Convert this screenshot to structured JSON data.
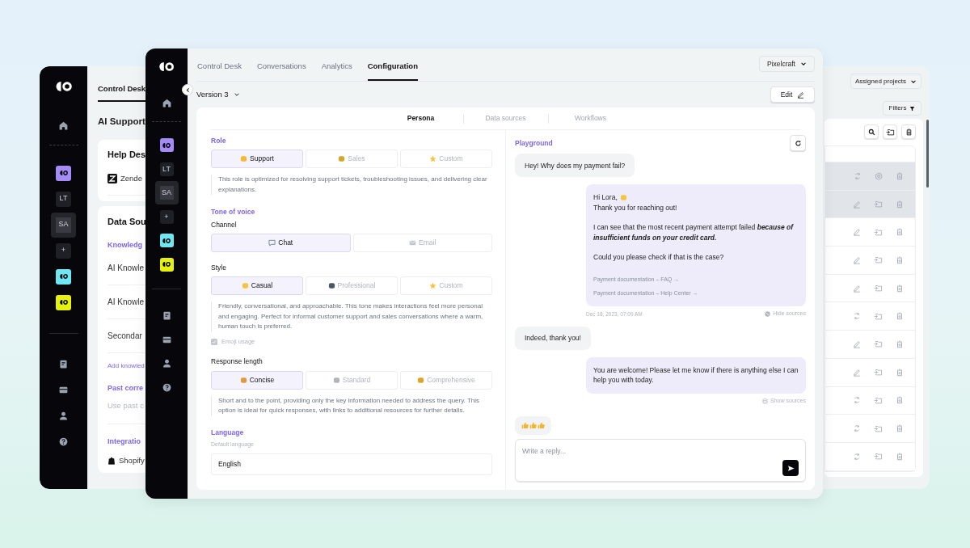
{
  "left_window": {
    "sidebar": {
      "workspaces": [
        {
          "kind": "logo",
          "color": "#a48bf5",
          "selected": false
        },
        {
          "kind": "initials",
          "label": "LT",
          "selected": false
        },
        {
          "kind": "initials",
          "label": "SA",
          "selected": true
        },
        {
          "kind": "add",
          "label": "+",
          "selected": false
        },
        {
          "kind": "logo",
          "color": "#6ee7f2",
          "selected": false
        },
        {
          "kind": "logo",
          "color": "#e6f20c",
          "selected": false
        }
      ]
    },
    "tab": "Control Desk",
    "heading": "AI Support",
    "cards": [
      {
        "title": "Help Des",
        "lines": [
          {
            "kind": "integration",
            "text": "Zende"
          }
        ]
      },
      {
        "title": "Data Sou",
        "lines": [
          {
            "kind": "section",
            "text": "Knowledg"
          },
          {
            "kind": "item",
            "text": "AI Knowle"
          },
          {
            "kind": "item",
            "text": "AI Knowle"
          },
          {
            "kind": "item",
            "text": "Secondar"
          },
          {
            "kind": "link",
            "text": "Add knowled"
          },
          {
            "kind": "section",
            "text": "Past corre"
          },
          {
            "kind": "hint",
            "text": "Use past c"
          },
          {
            "kind": "section",
            "text": "Integratio"
          },
          {
            "kind": "integration",
            "text": "Shopify"
          }
        ]
      }
    ]
  },
  "right_window": {
    "project_select": "Assigned projects",
    "filters": "Filters",
    "rows": [
      {
        "kind": "sync-settings",
        "highlighted": true
      },
      {
        "kind": "edit-move",
        "highlighted": true
      },
      {
        "kind": "edit-move",
        "highlighted": false
      },
      {
        "kind": "edit-move",
        "highlighted": false
      },
      {
        "kind": "edit-move",
        "highlighted": false
      },
      {
        "kind": "sync-move",
        "highlighted": false
      },
      {
        "kind": "edit-move",
        "highlighted": false
      },
      {
        "kind": "edit-move",
        "highlighted": false
      },
      {
        "kind": "sync-move",
        "highlighted": false
      },
      {
        "kind": "sync-move",
        "highlighted": false
      },
      {
        "kind": "sync-move",
        "highlighted": false
      }
    ]
  },
  "main_window": {
    "sidebar": {
      "workspaces": [
        {
          "kind": "logo",
          "color": "#a48bf5",
          "selected": false
        },
        {
          "kind": "initials",
          "label": "LT",
          "selected": false
        },
        {
          "kind": "initials",
          "label": "SA",
          "selected": true
        },
        {
          "kind": "add",
          "label": "+",
          "selected": false
        },
        {
          "kind": "logo",
          "color": "#6ee7f2",
          "selected": false
        },
        {
          "kind": "logo",
          "color": "#e6f20c",
          "selected": false
        }
      ]
    },
    "tabs": [
      {
        "label": "Control Desk",
        "selected": false
      },
      {
        "label": "Conversations",
        "selected": false
      },
      {
        "label": "Analytics",
        "selected": false
      },
      {
        "label": "Configuration",
        "selected": true
      }
    ],
    "workspace_select": "Pixelcraft",
    "version_select": "Version 3",
    "edit_button": "Edit",
    "subtabs": [
      {
        "label": "Persona",
        "selected": true
      },
      {
        "label": "Data sources",
        "selected": false
      },
      {
        "label": "Workflows",
        "selected": false
      }
    ],
    "persona": [
      {
        "kind": "heading",
        "text": "Role"
      },
      {
        "kind": "options",
        "options": [
          {
            "label": "Support",
            "kind": "handshake",
            "selected": true
          },
          {
            "label": "Sales",
            "kind": "moneybag",
            "selected": false
          },
          {
            "label": "Custom",
            "kind": "star",
            "selected": false
          }
        ]
      },
      {
        "kind": "description",
        "text": "This role is optimized for resolving support tickets, troubleshooting issues, and delivering clear explanations."
      },
      {
        "kind": "heading",
        "text": "Tone of voice"
      },
      {
        "kind": "label",
        "text": "Channel"
      },
      {
        "kind": "options",
        "options": [
          {
            "label": "Chat",
            "kind": "speech",
            "selected": true
          },
          {
            "label": "Email",
            "kind": "envelope",
            "selected": false
          }
        ]
      },
      {
        "kind": "label",
        "text": "Style"
      },
      {
        "kind": "options",
        "options": [
          {
            "label": "Casual",
            "kind": "wave",
            "selected": true
          },
          {
            "label": "Professional",
            "kind": "briefcase",
            "selected": false
          },
          {
            "label": "Custom",
            "kind": "star",
            "selected": false
          }
        ]
      },
      {
        "kind": "description",
        "text": "Friendly, conversational, and approachable. This tone makes interactions feel more personal and engaging. Perfect for informal customer support and sales conversations where a warm, human touch is preferred."
      },
      {
        "kind": "checkbox",
        "text": "Emoji usage",
        "checked": true
      },
      {
        "kind": "label",
        "text": "Response length"
      },
      {
        "kind": "options",
        "options": [
          {
            "label": "Concise",
            "kind": "target",
            "selected": true
          },
          {
            "label": "Standard",
            "kind": "scale",
            "selected": false
          },
          {
            "label": "Comprehensive",
            "kind": "books",
            "selected": false
          }
        ]
      },
      {
        "kind": "description",
        "text": "Short and to the point, providing only the key information needed to address the query. This option is ideal for quick responses, with links to additional resources for further details."
      },
      {
        "kind": "heading",
        "text": "Language"
      },
      {
        "kind": "caption",
        "text": "Default language"
      },
      {
        "kind": "field",
        "value": "English"
      }
    ],
    "playground": {
      "title": "Playground",
      "reply_placeholder": "Write a reply...",
      "messages": [
        {
          "kind": "question",
          "text": "Hey! Why does my payment fail?"
        },
        {
          "kind": "answer",
          "paragraphs": [
            [
              {
                "kind": "greeting",
                "text": "Hi Lora,"
              },
              {
                "kind": "plain",
                "text": "Thank you for reaching out!"
              }
            ],
            [
              {
                "kind": "plain",
                "text": "I can see that the most recent payment attempt failed **because of insufficient funds on your credit card.**"
              }
            ],
            [
              {
                "kind": "plain",
                "text": "Could you please check if that is the case?"
              }
            ]
          ],
          "sources": [
            "Payment documentation – FAQ →",
            "Payment documentation – Help Center →"
          ],
          "time": "Dec 18, 2023, 07:09 AM",
          "toggle": {
            "kind": "hide",
            "label": "Hide sources"
          }
        },
        {
          "kind": "question",
          "text": "Indeed, thank you!"
        },
        {
          "kind": "answer",
          "paragraphs": [
            [
              {
                "kind": "plain",
                "text": "You are welcome! Please let me know if there is anything else I can help you with today."
              }
            ]
          ],
          "toggle": {
            "kind": "show",
            "label": "Show sources"
          }
        },
        {
          "kind": "reaction"
        }
      ]
    }
  }
}
